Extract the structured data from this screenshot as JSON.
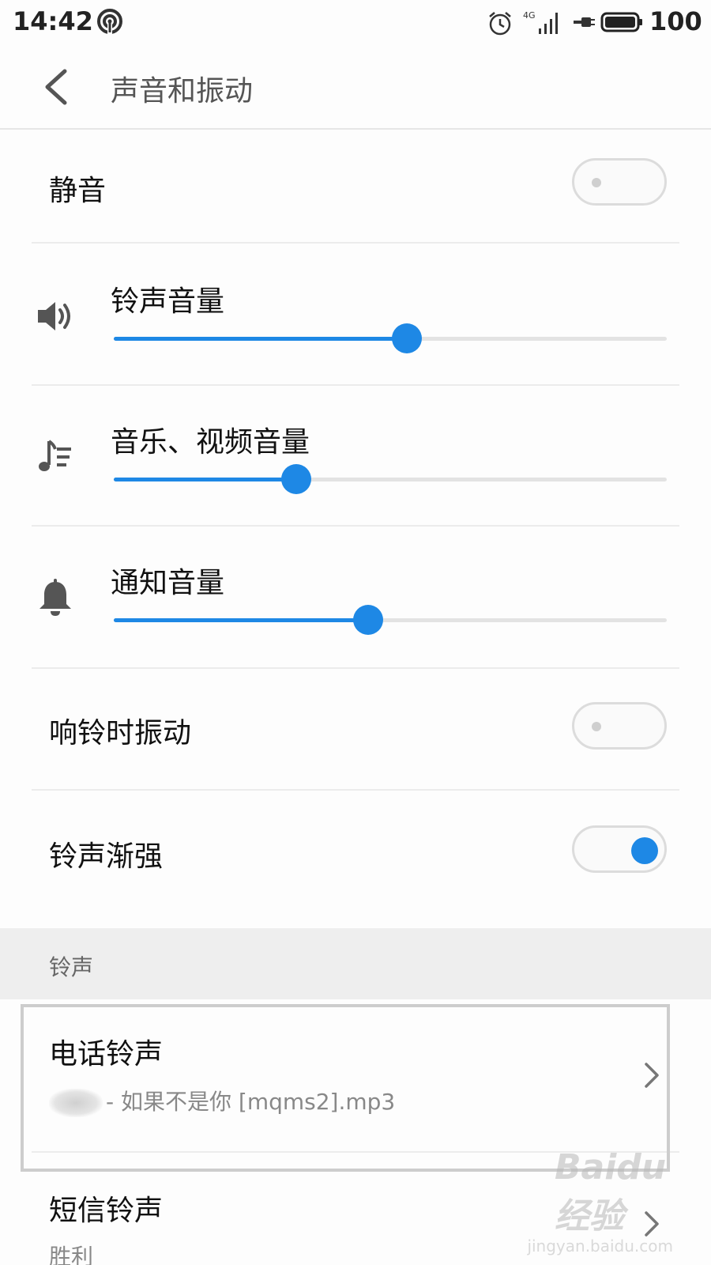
{
  "status_bar": {
    "time": "14:42",
    "battery_level": "100",
    "network": "4G"
  },
  "header": {
    "title": "声音和振动"
  },
  "settings": {
    "mute": {
      "label": "静音",
      "enabled": false
    },
    "ring_volume": {
      "label": "铃声音量",
      "level_pct": 53
    },
    "media_volume": {
      "label": "音乐、视频音量",
      "level_pct": 33
    },
    "notification_volume": {
      "label": "通知音量",
      "level_pct": 46
    },
    "vibrate_on_ring": {
      "label": "响铃时振动",
      "enabled": false
    },
    "ascending_ringtone": {
      "label": "铃声渐强",
      "enabled": true
    }
  },
  "ringtone_section": {
    "header": "铃声",
    "items": [
      {
        "title": "电话铃声",
        "subtitle": "- 如果不是你 [mqms2].mp3"
      },
      {
        "title": "短信铃声",
        "subtitle": "胜利"
      }
    ]
  },
  "watermark": {
    "brand": "Baidu经验",
    "url": "jingyan.baidu.com"
  },
  "colors": {
    "accent": "#1e88e5",
    "divider": "#ececec",
    "section_bg": "#eeeeee"
  }
}
